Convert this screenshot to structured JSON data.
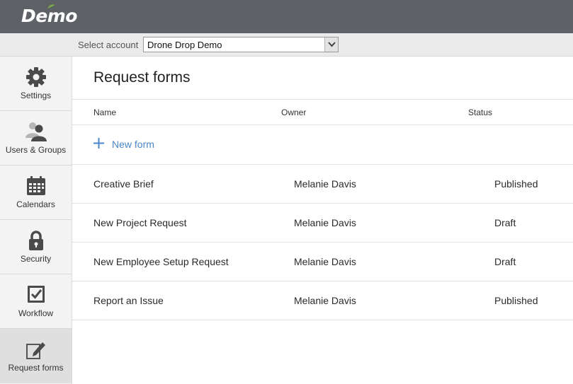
{
  "header": {
    "logo_text": "Demo",
    "accent_color": "#7cb342",
    "bar_color": "#5e6166"
  },
  "account": {
    "label": "Select account",
    "selected": "Drone Drop Demo"
  },
  "sidebar": {
    "items": [
      {
        "label": "Settings",
        "icon": "gear-icon"
      },
      {
        "label": "Users & Groups",
        "icon": "users-icon"
      },
      {
        "label": "Calendars",
        "icon": "calendar-icon"
      },
      {
        "label": "Security",
        "icon": "lock-icon"
      },
      {
        "label": "Workflow",
        "icon": "checkbox-icon"
      },
      {
        "label": "Request forms",
        "icon": "edit-form-icon",
        "active": true
      }
    ]
  },
  "main": {
    "title": "Request forms",
    "columns": {
      "name": "Name",
      "owner": "Owner",
      "status": "Status"
    },
    "new_form_label": "New form",
    "rows": [
      {
        "name": "Creative Brief",
        "owner": "Melanie Davis",
        "status": "Published"
      },
      {
        "name": "New Project Request",
        "owner": "Melanie Davis",
        "status": "Draft"
      },
      {
        "name": "New Employee Setup Request",
        "owner": "Melanie Davis",
        "status": "Draft"
      },
      {
        "name": "Report an Issue",
        "owner": "Melanie Davis",
        "status": "Published"
      }
    ]
  }
}
